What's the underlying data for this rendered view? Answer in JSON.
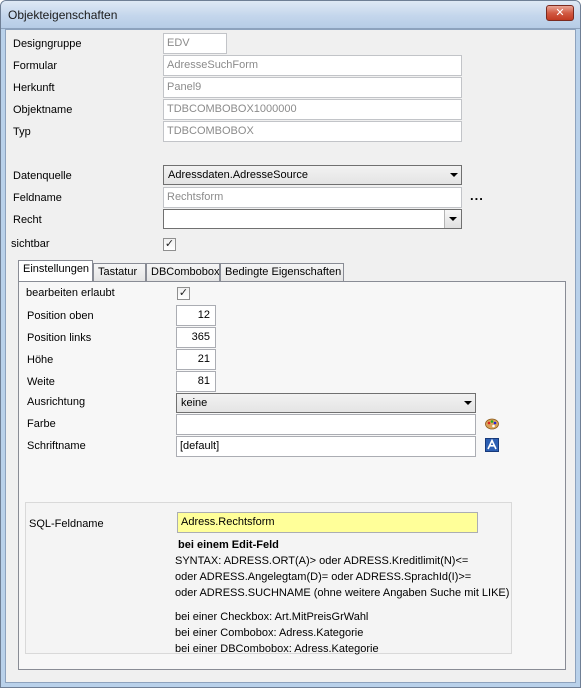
{
  "window": {
    "title": "Objekteigenschaften",
    "close_label": "✕"
  },
  "top": {
    "designgruppe_label": "Designgruppe",
    "designgruppe_value": "EDV",
    "formular_label": "Formular",
    "formular_value": "AdresseSuchForm",
    "herkunft_label": "Herkunft",
    "herkunft_value": "Panel9",
    "objektname_label": "Objektname",
    "objektname_value": "TDBCOMBOBOX1000000",
    "typ_label": "Typ",
    "typ_value": "TDBCOMBOBOX"
  },
  "data": {
    "datenquelle_label": "Datenquelle",
    "datenquelle_value": "Adressdaten.AdresseSource",
    "feldname_label": "Feldname",
    "feldname_value": "Rechtsform",
    "feldname_more": "...",
    "recht_label": "Recht",
    "recht_value": "",
    "sichtbar_label": "sichtbar",
    "sichtbar_checked": "✓"
  },
  "tabs": [
    {
      "label": "Einstellungen"
    },
    {
      "label": "Tastatur"
    },
    {
      "label": "DBCombobox"
    },
    {
      "label": "Bedingte Eigenschaften"
    }
  ],
  "settings": {
    "bearbeiten_label": "bearbeiten erlaubt",
    "bearbeiten_checked": "✓",
    "position_oben_label": "Position oben",
    "position_oben_value": "12",
    "position_links_label": "Position links",
    "position_links_value": "365",
    "hoehe_label": "Höhe",
    "hoehe_value": "21",
    "weite_label": "Weite",
    "weite_value": "81",
    "ausrichtung_label": "Ausrichtung",
    "ausrichtung_value": "keine",
    "farbe_label": "Farbe",
    "farbe_value": "",
    "schriftname_label": "Schriftname",
    "schriftname_value": "[default]"
  },
  "sql": {
    "label": "SQL-Feldname",
    "value": "Adress.Rechtsform",
    "heading": "bei einem Edit-Feld",
    "lines": [
      "SYNTAX: ADRESS.ORT(A)> oder ADRESS.Kreditlimit(N)<=",
      "oder ADRESS.Angelegtam(D)= oder ADRESS.SprachId(I)>=",
      "oder ADRESS.SUCHNAME (ohne weitere Angaben Suche mit LIKE)",
      "bei einer Checkbox: Art.MitPreisGrWahl",
      "bei einer Combobox: Adress.Kategorie",
      "bei einer DBCombobox: Adress.Kategorie"
    ]
  },
  "colors": {
    "sql_highlight": "#ffff99",
    "window_frame": "#b9d1ea"
  },
  "icons": {
    "farbe": "palette-icon",
    "schrift": "font-icon"
  }
}
